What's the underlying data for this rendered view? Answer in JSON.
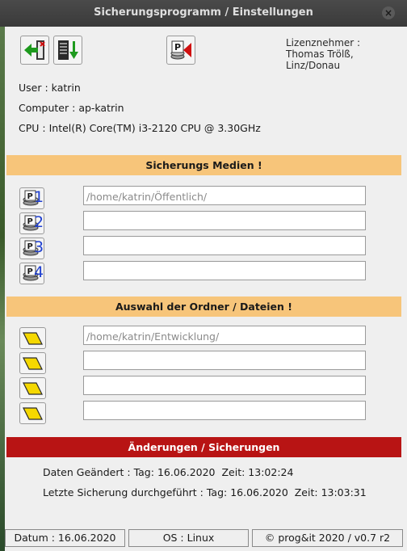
{
  "window": {
    "title": "Sicherungsprogramm / Einstellungen",
    "close_glyph": "×"
  },
  "toolbar": {
    "buttons": [
      {
        "icon": "exit-arrow-icon"
      },
      {
        "icon": "save-list-icon"
      },
      {
        "icon": "backup-run-icon"
      }
    ]
  },
  "licence": {
    "label": "Lizenznehmer :",
    "holder": "Thomas Trölß, Linz/Donau"
  },
  "system": {
    "user_label": "User :",
    "user": "katrin",
    "computer_label": "Computer :",
    "computer": "ap-katrin",
    "cpu_label": "CPU :",
    "cpu": "Intel(R) Core(TM) i3-2120 CPU @ 3.30GHz"
  },
  "media": {
    "heading": "Sicherungs Medien !",
    "items": [
      {
        "number": "1",
        "path": "/home/katrin/Öffentlich/"
      },
      {
        "number": "2",
        "path": ""
      },
      {
        "number": "3",
        "path": ""
      },
      {
        "number": "4",
        "path": ""
      }
    ]
  },
  "folders": {
    "heading": "Auswahl der Ordner / Dateien !",
    "items": [
      {
        "path": "/home/katrin/Entwicklung/"
      },
      {
        "path": ""
      },
      {
        "path": ""
      },
      {
        "path": ""
      }
    ]
  },
  "changes": {
    "heading": "Änderungen / Sicherungen",
    "changed_label": "Daten Geändert :",
    "changed_date_label": "Tag:",
    "changed_date": "16.06.2020",
    "changed_time_label": "Zeit:",
    "changed_time": "13:02:24",
    "backup_label": "Letzte Sicherung durchgeführt :",
    "backup_date_label": "Tag:",
    "backup_date": "16.06.2020",
    "backup_time_label": "Zeit:",
    "backup_time": "13:03:31"
  },
  "status": {
    "date": "Datum : 16.06.2020",
    "os": "OS : Linux",
    "copyright": "© prog&it 2020 / v0.7 r2"
  },
  "colors": {
    "section_bar": "#f7c57a",
    "changes_bar": "#b81414",
    "media_number": "#2040d0",
    "folder_icon": "#f5d800"
  }
}
